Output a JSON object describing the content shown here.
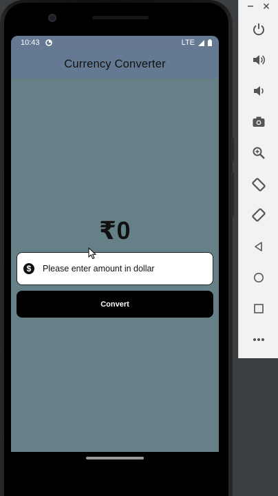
{
  "status_bar": {
    "time": "10:43",
    "network": "LTE"
  },
  "app_bar": {
    "title": "Currency Converter"
  },
  "converter": {
    "result": "₹0",
    "input_placeholder": "Please enter amount in dollar",
    "input_value": "",
    "convert_label": "Convert"
  },
  "icons": {
    "input_prefix": "dollar-circle-icon",
    "status_left": "sync-icon",
    "status_right": [
      "signal-icon",
      "battery-icon"
    ]
  },
  "colors": {
    "screen_background": "#668088",
    "app_bar_background": "#647a92",
    "button_background": "#000000",
    "button_text": "#ffffff"
  },
  "emulator_toolbar": {
    "items": [
      "minimize-icon",
      "close-icon",
      "power-icon",
      "volume-up-icon",
      "volume-down-icon",
      "camera-icon",
      "zoom-icon",
      "rotate-left-icon",
      "rotate-right-icon",
      "back-icon",
      "home-icon",
      "overview-icon",
      "more-icon"
    ]
  }
}
